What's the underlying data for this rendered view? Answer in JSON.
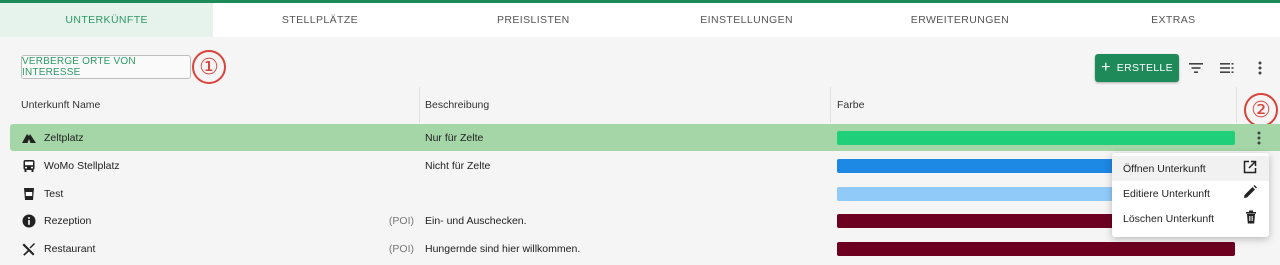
{
  "tabs": [
    {
      "label": "UNTERKÜNFTE",
      "active": true
    },
    {
      "label": "STELLPLÄTZE",
      "active": false
    },
    {
      "label": "PREISLISTEN",
      "active": false
    },
    {
      "label": "EINSTELLUNGEN",
      "active": false
    },
    {
      "label": "ERWEITERUNGEN",
      "active": false
    },
    {
      "label": "EXTRAS",
      "active": false
    }
  ],
  "toolbar": {
    "hide_poi_label": "VERBERGE ORTE VON INTERESSE",
    "create_label": "ERSTELLE",
    "filter_icon": "filter-icon",
    "columns_icon": "column-settings-icon",
    "more_icon": "more-vert-icon"
  },
  "callouts": {
    "one": "①",
    "two": "②"
  },
  "table": {
    "headers": {
      "name": "Unterkunft Name",
      "description": "Beschreibung",
      "color": "Farbe"
    },
    "rows": [
      {
        "name": "Zeltplatz",
        "icon": "tent-icon",
        "poi": "",
        "description": "Nur für Zelte",
        "color": "#1fcf7a",
        "selected": true
      },
      {
        "name": "WoMo Stellplatz",
        "icon": "camper-icon",
        "poi": "",
        "description": "Nicht für Zelte",
        "color": "#1e88e5",
        "selected": false
      },
      {
        "name": "Test",
        "icon": "cup-icon",
        "poi": "",
        "description": "",
        "color": "#90caf9",
        "selected": false
      },
      {
        "name": "Rezeption",
        "icon": "info-icon",
        "poi": "(POI)",
        "description": "Ein- und Auschecken.",
        "color": "#6d0021",
        "selected": false
      },
      {
        "name": "Restaurant",
        "icon": "restaurant-icon",
        "poi": "(POI)",
        "description": "Hungernde sind hier willkommen.",
        "color": "#6d0021",
        "selected": false
      }
    ]
  },
  "context_menu": {
    "items": [
      {
        "label": "Öffnen Unterkunft",
        "icon": "open-in-new-icon"
      },
      {
        "label": "Editiere Unterkunft",
        "icon": "pencil-icon"
      },
      {
        "label": "Löschen Unterkunft",
        "icon": "trash-icon"
      }
    ]
  },
  "colors": {
    "accent": "#1e8a5a",
    "selected_row": "#a5d6a7",
    "callout": "#d8433a"
  }
}
